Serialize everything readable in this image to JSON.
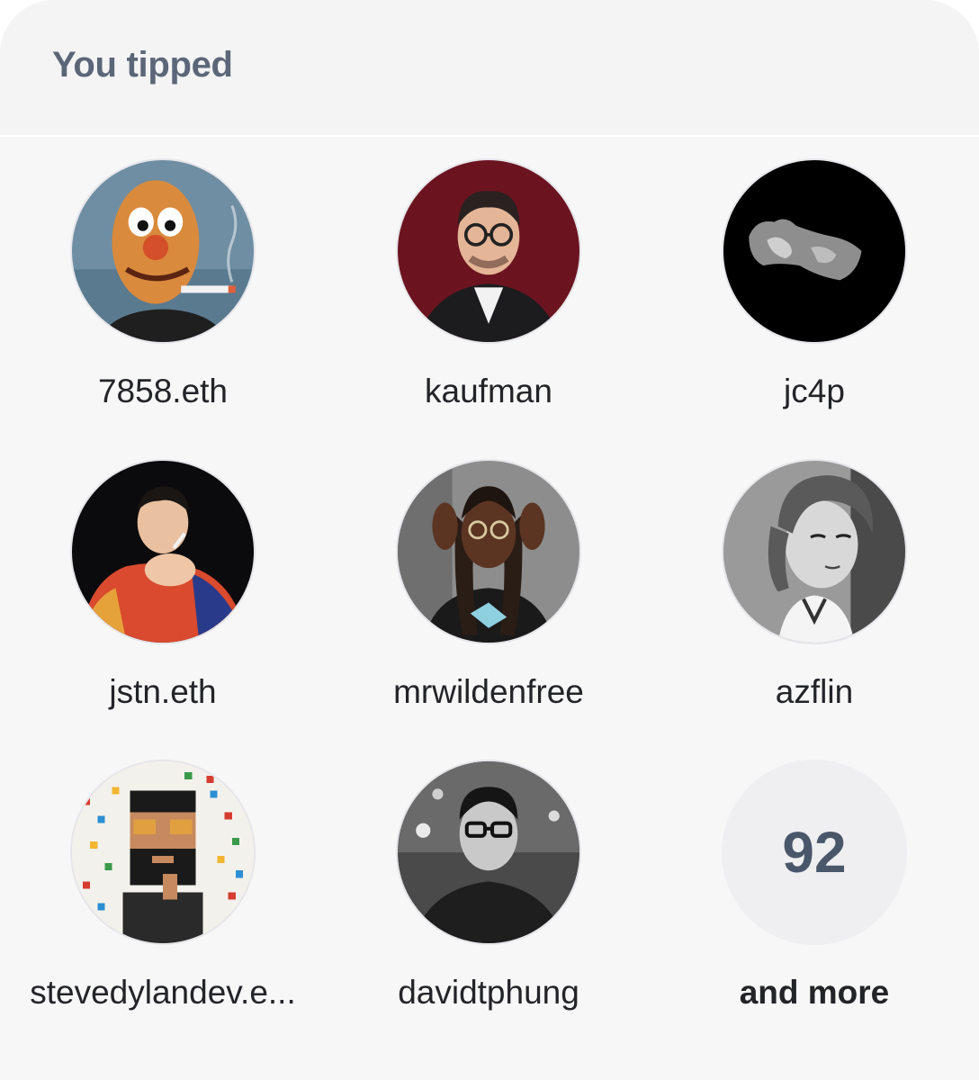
{
  "header": {
    "title": "You tipped"
  },
  "users": [
    {
      "name": "7858.eth",
      "avatar": "orange-puppet-smoking-avatar"
    },
    {
      "name": "kaufman",
      "avatar": "man-with-glasses-red-background-avatar"
    },
    {
      "name": "jc4p",
      "avatar": "grey-3d-shape-black-background-avatar"
    },
    {
      "name": "jstn.eth",
      "avatar": "man-lighting-cigarette-avatar"
    },
    {
      "name": "mrwildenfree",
      "avatar": "man-with-dreadlocks-avatar"
    },
    {
      "name": "azflin",
      "avatar": "cartoon-girl-grayscale-avatar"
    },
    {
      "name": "stevedylandev.e...",
      "avatar": "pixel-art-bearded-man-avatar"
    },
    {
      "name": "davidtphung",
      "avatar": "man-with-glasses-grayscale-avatar"
    }
  ],
  "more": {
    "count": "92",
    "label": "and more"
  },
  "colors": {
    "background": "#f7f7f8",
    "header_text": "#5b6678",
    "name_text": "#232428",
    "more_circle": "#efeff1",
    "more_count": "#4a576b"
  }
}
